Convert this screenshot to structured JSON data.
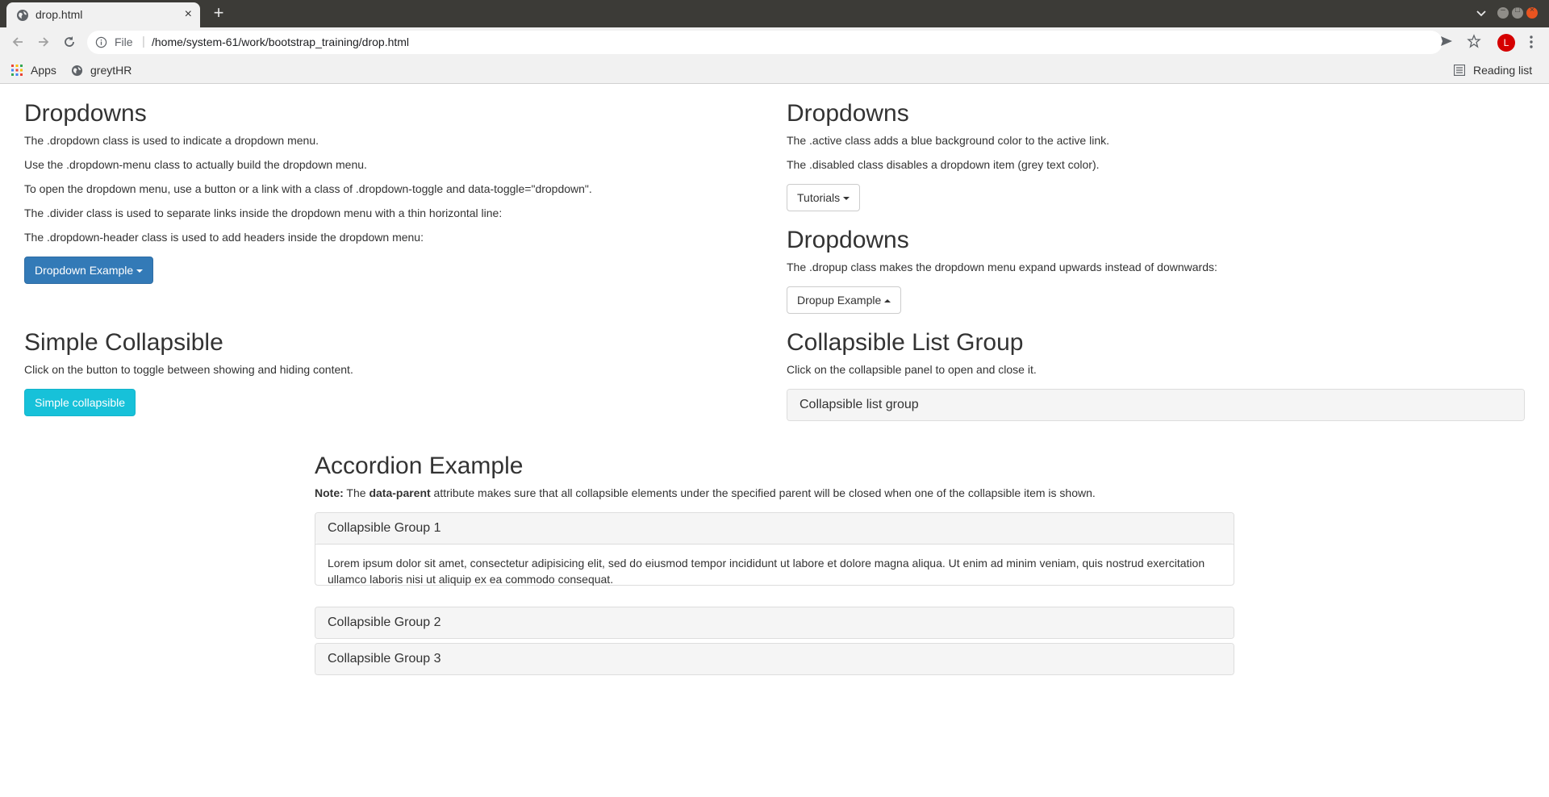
{
  "browser": {
    "tab_title": "drop.html",
    "tab_close": "×",
    "new_tab": "+",
    "scheme_label": "File",
    "url": "/home/system-61/work/bootstrap_training/drop.html",
    "profile_initial": "L",
    "bookmarks": [
      {
        "label": "Apps",
        "icon": "apps-grid-icon"
      },
      {
        "label": "greytHR",
        "icon": "globe-icon"
      }
    ],
    "reading_list": "Reading list"
  },
  "left_dropdowns": {
    "title": "Dropdowns",
    "paragraphs": [
      "The .dropdown class is used to indicate a dropdown menu.",
      "Use the .dropdown-menu class to actually build the dropdown menu.",
      "To open the dropdown menu, use a button or a link with a class of .dropdown-toggle and data-toggle=\"dropdown\".",
      "The .divider class is used to separate links inside the dropdown menu with a thin horizontal line:",
      "The .dropdown-header class is used to add headers inside the dropdown menu:"
    ],
    "button": "Dropdown Example"
  },
  "right_dropdowns_active": {
    "title": "Dropdowns",
    "paragraphs": [
      "The .active class adds a blue background color to the active link.",
      "The .disabled class disables a dropdown item (grey text color)."
    ],
    "button": "Tutorials"
  },
  "right_dropup": {
    "title": "Dropdowns",
    "paragraph": "The .dropup class makes the dropdown menu expand upwards instead of downwards:",
    "button": "Dropup Example"
  },
  "simple_collapsible": {
    "title": "Simple Collapsible",
    "paragraph": "Click on the button to toggle between showing and hiding content.",
    "button": "Simple collapsible"
  },
  "collapsible_list_group": {
    "title": "Collapsible List Group",
    "paragraph": "Click on the collapsible panel to open and close it.",
    "panel_heading": "Collapsible list group"
  },
  "accordion": {
    "title": "Accordion Example",
    "note_label": "Note:",
    "note_text_1": " The ",
    "note_bold": "data-parent",
    "note_text_2": " attribute makes sure that all collapsible elements under the specified parent will be closed when one of the collapsible item is shown.",
    "groups": [
      {
        "heading": "Collapsible Group 1",
        "body": "Lorem ipsum dolor sit amet, consectetur adipisicing elit, sed do eiusmod tempor incididunt ut labore et dolore magna aliqua. Ut enim ad minim veniam, quis nostrud exercitation ullamco laboris nisi ut aliquip ex ea commodo consequat.",
        "expanded": true
      },
      {
        "heading": "Collapsible Group 2",
        "expanded": false
      },
      {
        "heading": "Collapsible Group 3",
        "expanded": false
      }
    ]
  },
  "colors": {
    "primary": "#337ab7",
    "info": "#17c1d9",
    "panel_heading_bg": "#f5f5f5",
    "chrome_dark": "#3c3b37",
    "window_close": "#e95420"
  }
}
